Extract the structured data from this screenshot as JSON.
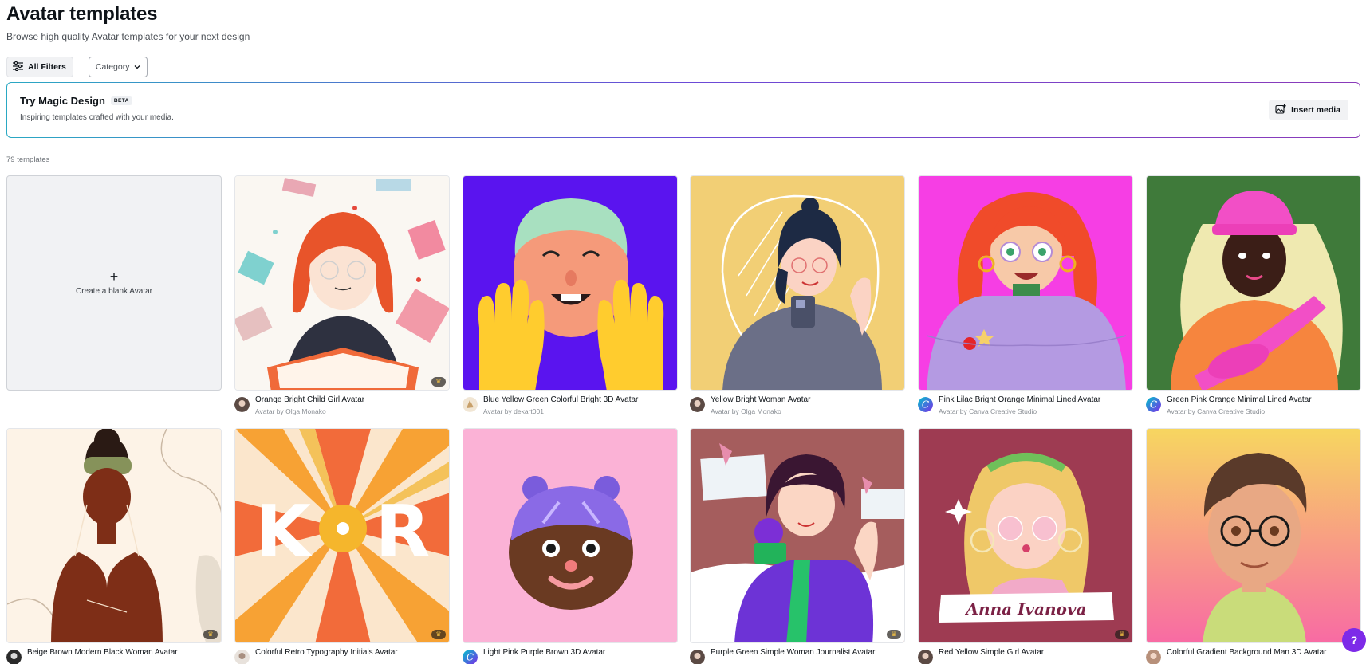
{
  "header": {
    "title": "Avatar templates",
    "subtitle": "Browse high quality Avatar templates for your next design"
  },
  "filters": {
    "all_filters_label": "All Filters",
    "category_label": "Category"
  },
  "magic_design": {
    "title": "Try Magic Design",
    "badge": "BETA",
    "subtitle": "Inspiring templates crafted with your media.",
    "button_label": "Insert media"
  },
  "results": {
    "count_label": "79 templates",
    "blank_label": "Create a blank Avatar"
  },
  "templates": [
    {
      "title": "Orange Bright Child Girl Avatar",
      "author": "Avatar by Olga Monako",
      "premium": true
    },
    {
      "title": "Blue Yellow Green Colorful Bright 3D Avatar",
      "author": "Avatar by dekart001",
      "premium": false
    },
    {
      "title": "Yellow Bright Woman Avatar",
      "author": "Avatar by Olga Monako",
      "premium": false
    },
    {
      "title": "Pink Lilac Bright Orange Minimal Lined Avatar",
      "author": "Avatar by Canva Creative Studio",
      "premium": false
    },
    {
      "title": "Green Pink Orange Minimal Lined Avatar",
      "author": "Avatar by Canva Creative Studio",
      "premium": false
    },
    {
      "title": "Beige Brown Modern Black Woman Avatar",
      "author": "",
      "premium": true
    },
    {
      "title": "Colorful Retro Typography Initials Avatar",
      "author": "",
      "premium": true,
      "initial_left": "K",
      "initial_right": "R"
    },
    {
      "title": "Light Pink Purple Brown 3D Avatar",
      "author": "",
      "premium": false
    },
    {
      "title": "Purple Green Simple Woman Journalist Avatar",
      "author": "",
      "premium": true
    },
    {
      "title": "Red Yellow Simple Girl Avatar",
      "author": "",
      "premium": true,
      "name_banner": "Anna Ivanova"
    },
    {
      "title": "Colorful Gradient Background Man 3D Avatar",
      "author": "",
      "premium": false
    }
  ],
  "help": {
    "label": "?"
  },
  "colors": {
    "brand": "#7d2ae8",
    "premium_crown": "#f5c242"
  },
  "icons": [
    "sliders-icon",
    "chevron-down-icon",
    "image-plus-icon",
    "plus-icon",
    "crown-icon",
    "help-icon"
  ]
}
